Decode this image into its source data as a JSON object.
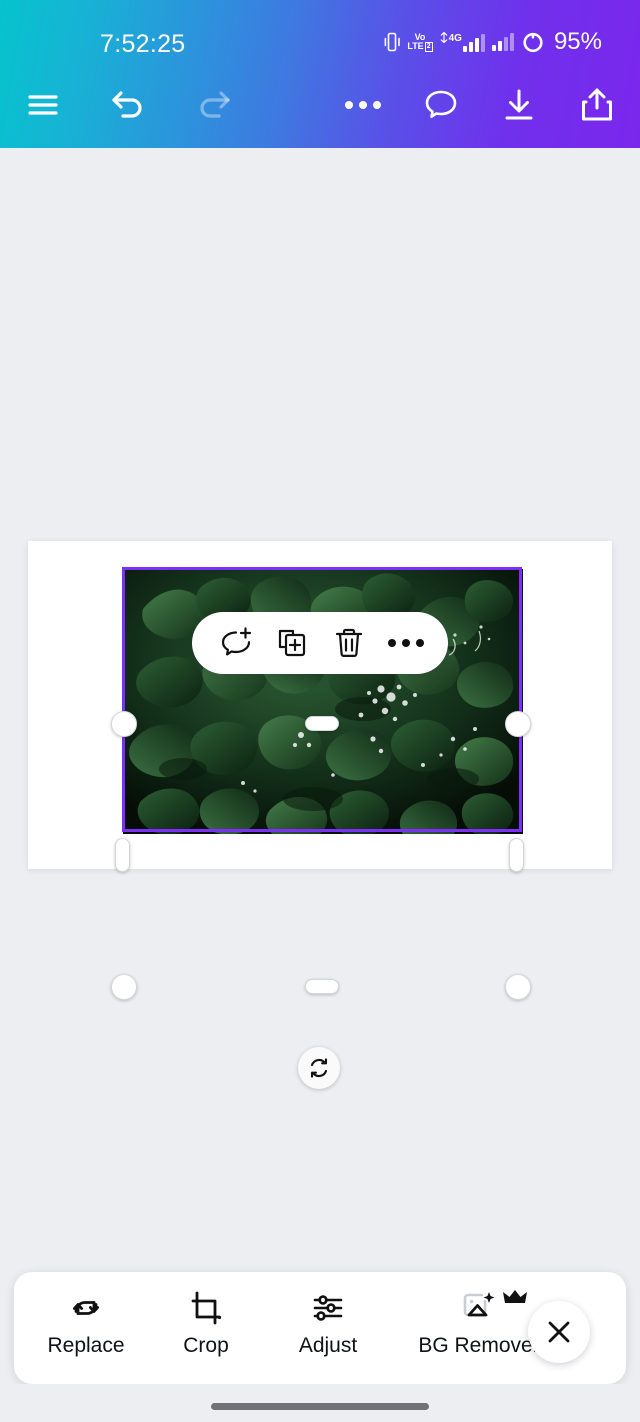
{
  "status_bar": {
    "time": "7:52:25",
    "battery_percent": "95%",
    "network_label_top": "Vo",
    "network_label_bottom": "LTE",
    "sim_badge": "2",
    "data_type": "4G",
    "icons": [
      "vibrate-icon",
      "volte-icon",
      "signal-4g-icon",
      "signal-secondary-icon",
      "battery-icon"
    ]
  },
  "header": {
    "gradient_from": "#06c3cd",
    "gradient_to": "#7a27ec",
    "buttons": [
      {
        "name": "menu-button",
        "icon": "hamburger-menu-icon",
        "enabled": true
      },
      {
        "name": "undo-button",
        "icon": "undo-arrow-icon",
        "enabled": true
      },
      {
        "name": "redo-button",
        "icon": "redo-arrow-icon",
        "enabled": false
      },
      {
        "name": "more-options-button",
        "icon": "more-horizontal-icon",
        "enabled": true
      },
      {
        "name": "comment-button",
        "icon": "comment-bubble-icon",
        "enabled": true
      },
      {
        "name": "download-button",
        "icon": "download-arrow-icon",
        "enabled": true
      },
      {
        "name": "share-button",
        "icon": "share-upload-icon",
        "enabled": true
      }
    ]
  },
  "canvas": {
    "background_color": "#eceef2",
    "card_background": "#ffffff",
    "selection_color": "#7b2ff7",
    "selected_element": "image-element",
    "image_description": "dark green leafy foliage with water droplets"
  },
  "context_toolbar": {
    "items": [
      {
        "name": "add-comment-action",
        "icon": "comment-plus-icon"
      },
      {
        "name": "duplicate-action",
        "icon": "duplicate-plus-icon"
      },
      {
        "name": "delete-action",
        "icon": "trash-icon"
      },
      {
        "name": "more-actions",
        "icon": "more-horizontal-icon"
      }
    ]
  },
  "rotate_handle": {
    "name": "rotate-handle",
    "icon": "rotate-refresh-icon"
  },
  "bottom_bar": {
    "items": [
      {
        "label": "Replace",
        "icon": "replace-arrows-icon",
        "premium": false
      },
      {
        "label": "Crop",
        "icon": "crop-icon",
        "premium": false
      },
      {
        "label": "Adjust",
        "icon": "sliders-icon",
        "premium": false
      },
      {
        "label": "BG Remover",
        "icon": "bg-remover-icon",
        "premium": true,
        "badge": "crown-icon"
      }
    ],
    "close_label": "close",
    "close_icon": "close-x-icon"
  }
}
